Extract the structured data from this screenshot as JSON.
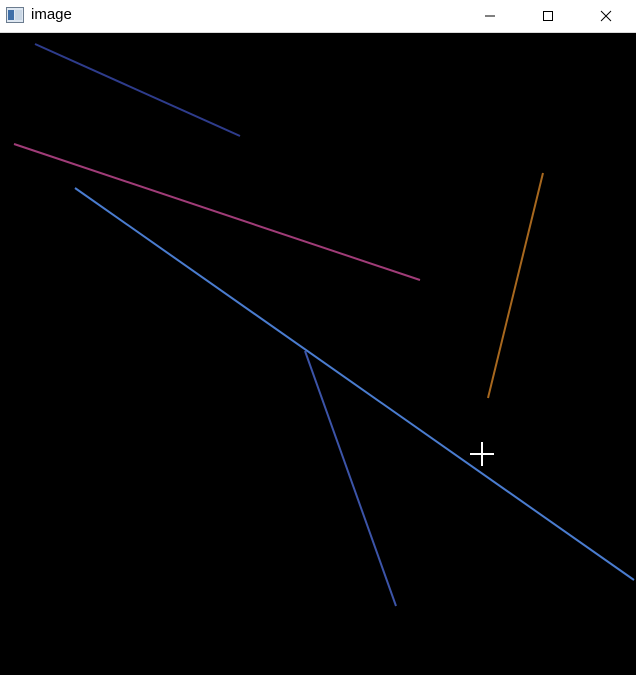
{
  "window": {
    "title": "image",
    "controls": {
      "minimize_icon": "minimize-icon",
      "maximize_icon": "maximize-icon",
      "close_icon": "close-icon"
    }
  },
  "canvas": {
    "background": "#000000",
    "line_colors": [
      "#2e3c8c",
      "#a03c78",
      "#4a7ccf",
      "#3c54a8",
      "#a8681e"
    ],
    "cursor": "crosshair",
    "cursor_color": "#ffffff"
  }
}
